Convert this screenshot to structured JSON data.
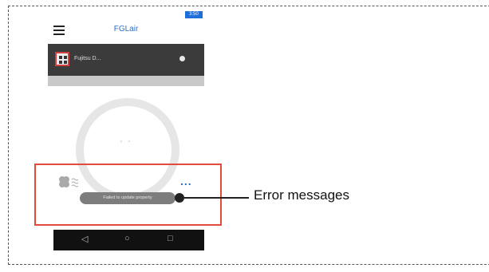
{
  "app": {
    "status_time": "3:50",
    "title": "FGLair",
    "device_name": "Fujitsu D...",
    "temperature": "- -",
    "more_icon": "...",
    "toast": "Failed to update property",
    "nav": {
      "back": "◁",
      "home": "○",
      "recent": "□"
    }
  },
  "annotation": {
    "label": "Error messages"
  },
  "colors": {
    "highlight": "#e24a3c",
    "accent": "#2a6fc7",
    "device_bar": "#3b3b3b"
  },
  "icons": [
    "hamburger-icon",
    "device-icon",
    "power-icon",
    "fan-icon",
    "more-icon",
    "back-icon",
    "home-icon",
    "recent-apps-icon"
  ]
}
